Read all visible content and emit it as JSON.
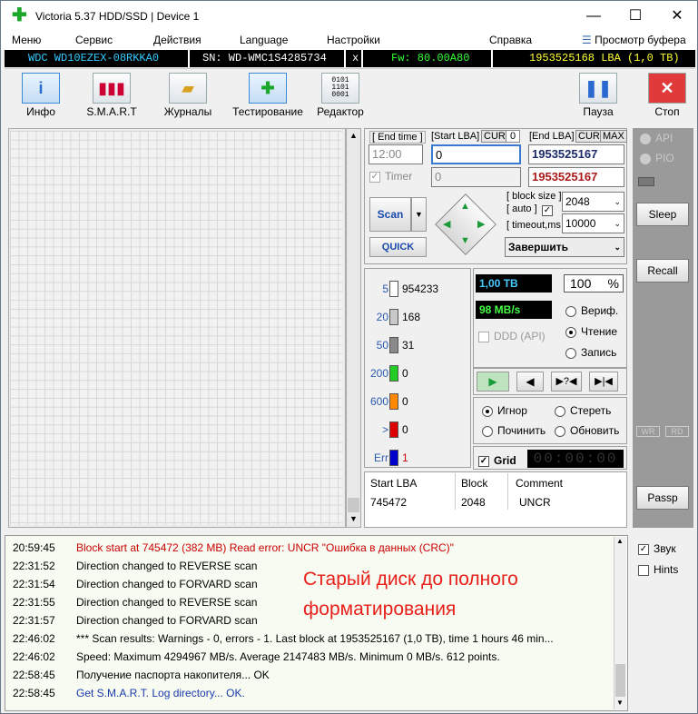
{
  "window": {
    "title": "Victoria 5.37 HDD/SSD | Device 1"
  },
  "menu": [
    "Меню",
    "Сервис",
    "Действия",
    "Language",
    "Настройки",
    "Справка"
  ],
  "menu_buffer": "Просмотр буфера",
  "infobar": {
    "model": "WDC WD10EZEX-08RKKA0",
    "serial": "SN: WD-WMC1S4285734",
    "x": "x",
    "fw": "Fw: 80.00A80",
    "lba": "1953525168 LBA (1,0 TB)"
  },
  "toolbar": {
    "info": "Инфо",
    "smart": "S.M.A.R.T",
    "journals": "Журналы",
    "testing": "Тестирование",
    "editor": "Редактор",
    "pause": "Пауза",
    "stop": "Стоп"
  },
  "scan": {
    "end_time_lbl": "[ End time ]",
    "start_lba_lbl": "[Start LBA]",
    "cur": "CUR",
    "cur_val": "0",
    "end_lba_lbl": "[End LBA]",
    "cur2": "CUR",
    "max": "MAX",
    "time_val": "12:00",
    "start_val": "0",
    "end_val": "1953525167",
    "timer_lbl": "Timer",
    "timer_val": "0",
    "end_val2": "1953525167",
    "block_size_lbl": "[ block size ]",
    "auto_lbl": "[ auto ]",
    "timeout_lbl": "[ timeout,ms ]",
    "block_size": "2048",
    "timeout": "10000",
    "scan_btn": "Scan",
    "quick_btn": "QUICK",
    "finish": "Завершить"
  },
  "stats": [
    {
      "label": "5",
      "count": "954233",
      "color": "#ffffff"
    },
    {
      "label": "20",
      "count": "168",
      "color": "#c8c8c8"
    },
    {
      "label": "50",
      "count": "31",
      "color": "#8a8a8a"
    },
    {
      "label": "200",
      "count": "0",
      "color": "#22cc22"
    },
    {
      "label": "600",
      "count": "0",
      "color": "#ff8800"
    },
    {
      "label": ">",
      "count": "0",
      "color": "#dd0000"
    },
    {
      "label": "Err",
      "count": "1",
      "color": "#0000cc"
    }
  ],
  "readout": {
    "tb": "1,00 TB",
    "pct": "100",
    "pct_sign": "%",
    "speed": "98 MB/s",
    "ddd": "DDD (API)",
    "verify": "Вериф.",
    "read": "Чтение",
    "write": "Запись"
  },
  "actions": {
    "ignore": "Игнор",
    "erase": "Стереть",
    "repair": "Починить",
    "refresh": "Обновить",
    "grid": "Grid",
    "clock": "00:00:00"
  },
  "table": {
    "headers": [
      "Start LBA",
      "Block",
      "Comment"
    ],
    "rows": [
      [
        "745472",
        "2048",
        "UNCR"
      ]
    ]
  },
  "right": {
    "api": "API",
    "pio": "PIO",
    "sleep": "Sleep",
    "recall": "Recall",
    "wr": "WR",
    "rd": "RD",
    "passp": "Passp",
    "sound": "Звук",
    "hints": "Hints"
  },
  "log": [
    {
      "t": "20:59:45",
      "m": "Block start at 745472 (382 MB) Read error: UNCR \"Ошибка в данных (CRC)\"",
      "c": "#cc0000"
    },
    {
      "t": "22:31:52",
      "m": "Direction changed to REVERSE scan",
      "c": "#000"
    },
    {
      "t": "22:31:54",
      "m": "Direction changed to FORVARD scan",
      "c": "#000"
    },
    {
      "t": "22:31:55",
      "m": "Direction changed to REVERSE scan",
      "c": "#000"
    },
    {
      "t": "22:31:57",
      "m": "Direction changed to FORVARD scan",
      "c": "#000"
    },
    {
      "t": "22:46:02",
      "m": "*** Scan results: Warnings - 0, errors - 1. Last block at 1953525167 (1,0 TB), time 1 hours 46 min...",
      "c": "#000"
    },
    {
      "t": "22:46:02",
      "m": "Speed: Maximum 4294967 MB/s. Average 2147483 MB/s. Minimum 0 MB/s. 612 points.",
      "c": "#000"
    },
    {
      "t": "22:58:45",
      "m": "Получение паспорта накопителя... OK",
      "c": "#000"
    },
    {
      "t": "22:58:45",
      "m": "Get S.M.A.R.T. Log directory... OK.",
      "c": "#1a3aa8"
    }
  ],
  "overlay": "Старый диск до полного форматирования"
}
